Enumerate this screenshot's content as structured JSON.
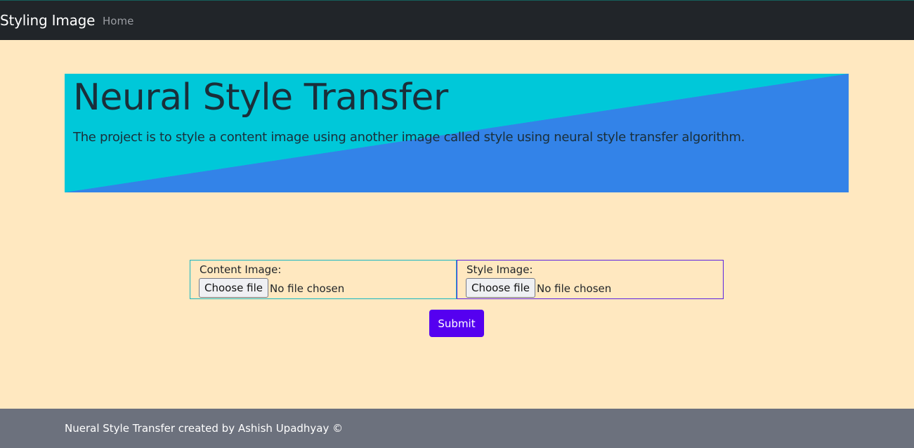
{
  "navbar": {
    "brand": "Styling Image",
    "links": [
      {
        "label": "Home"
      }
    ]
  },
  "hero": {
    "title": "Neural Style Transfer",
    "description": "The project is to style a content image using another image called style using neural style transfer algorithm."
  },
  "form": {
    "content_image": {
      "label": "Content Image:",
      "button_label": "Choose file",
      "status": "No file chosen"
    },
    "style_image": {
      "label": "Style Image:",
      "button_label": "Choose file",
      "status": "No file chosen"
    },
    "submit_label": "Submit"
  },
  "footer": {
    "text": "Nueral Style Transfer created by Ashish Upadhyay ©"
  },
  "colors": {
    "page_background": "#ffe8c0",
    "navbar": "#212529",
    "hero_cyan": "#00c8d9",
    "hero_blue": "#3383e8",
    "submit": "#5500f0",
    "footer": "#6c717d"
  }
}
